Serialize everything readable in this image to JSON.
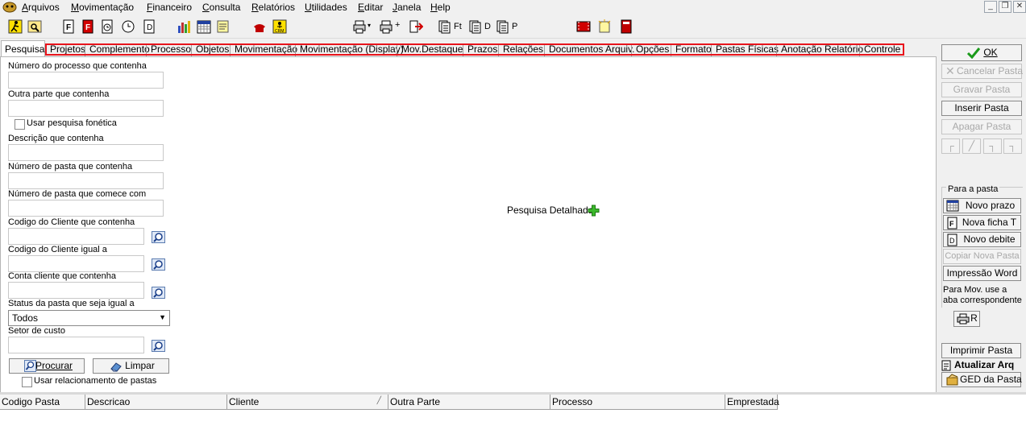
{
  "menu": {
    "items": [
      "Arquivos",
      "Movimentação",
      "Financeiro",
      "Consulta",
      "Relatórios",
      "Utilidades",
      "Editar",
      "Janela",
      "Help"
    ]
  },
  "toolbar": {
    "label_ft": "Ft",
    "label_d": "D",
    "label_p": "P"
  },
  "tabs": {
    "active": "Pesquisa",
    "items": [
      "Projetos",
      "Complemento",
      "Processo",
      "Objetos",
      "Movimentação",
      "Movimentação (Display)",
      "Mov.Destaque",
      "Prazos",
      "Relações",
      "Documentos Arquiv.",
      "Opções",
      "Formato",
      "Pastas Físicas",
      "Anotação Relatório",
      "Controle"
    ]
  },
  "form": {
    "numero_processo_label": "Número do processo que contenha",
    "outra_parte_label": "Outra parte que contenha",
    "fonetica_label": "Usar pesquisa fonética",
    "descricao_label": "Descrição que contenha",
    "numero_pasta_contenha_label": "Número de pasta que contenha",
    "numero_pasta_comece_label": "Número de pasta que comece com",
    "codigo_cliente_contenha_label": "Codigo do Cliente que contenha",
    "codigo_cliente_igual_label": "Codigo do Cliente igual a",
    "conta_cliente_label": "Conta cliente que contenha",
    "status_label": "Status da pasta que seja igual a",
    "status_value": "Todos",
    "setor_label": "Setor de custo",
    "procurar_label": "Procurar",
    "limpar_label": "Limpar",
    "relacionamento_label": "Usar relacionamento de pastas"
  },
  "center": {
    "pesquisa_detalhada": "Pesquisa Detalhada"
  },
  "right": {
    "ok": "OK",
    "cancelar": "Cancelar Pasta",
    "gravar": "Gravar Pasta",
    "inserir": "Inserir Pasta",
    "apagar": "Apagar Pasta",
    "para_pasta": "Para a pasta",
    "novo_prazo": "Novo prazo",
    "nova_ficha": "Nova ficha T",
    "novo_debite": "Novo debite",
    "copiar": "Copiar Nova  Pasta",
    "impressao_word": "Impressão Word",
    "para_mov": "Para Mov. use a aba correspondente",
    "r_label": "R",
    "imprimir": "Imprimir Pasta",
    "atualizar": "Atualizar Arq",
    "ged": "GED da Pasta"
  },
  "grid": {
    "columns": [
      "Codigo Pasta",
      "Descricao",
      "Cliente",
      "Outra Parte",
      "Processo",
      "Emprestada"
    ]
  },
  "colors": {
    "highlight": "#e8141c",
    "ok_check": "#1a9a1a",
    "plus": "#3cb82c"
  }
}
